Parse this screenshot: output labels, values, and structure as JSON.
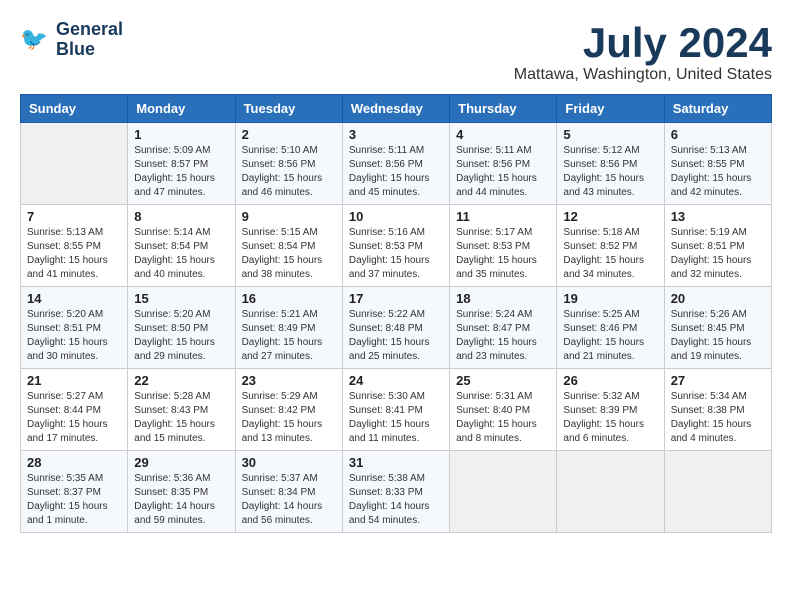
{
  "logo": {
    "line1": "General",
    "line2": "Blue"
  },
  "title": "July 2024",
  "location": "Mattawa, Washington, United States",
  "days_of_week": [
    "Sunday",
    "Monday",
    "Tuesday",
    "Wednesday",
    "Thursday",
    "Friday",
    "Saturday"
  ],
  "weeks": [
    [
      {
        "day": "",
        "info": ""
      },
      {
        "day": "1",
        "info": "Sunrise: 5:09 AM\nSunset: 8:57 PM\nDaylight: 15 hours\nand 47 minutes."
      },
      {
        "day": "2",
        "info": "Sunrise: 5:10 AM\nSunset: 8:56 PM\nDaylight: 15 hours\nand 46 minutes."
      },
      {
        "day": "3",
        "info": "Sunrise: 5:11 AM\nSunset: 8:56 PM\nDaylight: 15 hours\nand 45 minutes."
      },
      {
        "day": "4",
        "info": "Sunrise: 5:11 AM\nSunset: 8:56 PM\nDaylight: 15 hours\nand 44 minutes."
      },
      {
        "day": "5",
        "info": "Sunrise: 5:12 AM\nSunset: 8:56 PM\nDaylight: 15 hours\nand 43 minutes."
      },
      {
        "day": "6",
        "info": "Sunrise: 5:13 AM\nSunset: 8:55 PM\nDaylight: 15 hours\nand 42 minutes."
      }
    ],
    [
      {
        "day": "7",
        "info": "Sunrise: 5:13 AM\nSunset: 8:55 PM\nDaylight: 15 hours\nand 41 minutes."
      },
      {
        "day": "8",
        "info": "Sunrise: 5:14 AM\nSunset: 8:54 PM\nDaylight: 15 hours\nand 40 minutes."
      },
      {
        "day": "9",
        "info": "Sunrise: 5:15 AM\nSunset: 8:54 PM\nDaylight: 15 hours\nand 38 minutes."
      },
      {
        "day": "10",
        "info": "Sunrise: 5:16 AM\nSunset: 8:53 PM\nDaylight: 15 hours\nand 37 minutes."
      },
      {
        "day": "11",
        "info": "Sunrise: 5:17 AM\nSunset: 8:53 PM\nDaylight: 15 hours\nand 35 minutes."
      },
      {
        "day": "12",
        "info": "Sunrise: 5:18 AM\nSunset: 8:52 PM\nDaylight: 15 hours\nand 34 minutes."
      },
      {
        "day": "13",
        "info": "Sunrise: 5:19 AM\nSunset: 8:51 PM\nDaylight: 15 hours\nand 32 minutes."
      }
    ],
    [
      {
        "day": "14",
        "info": "Sunrise: 5:20 AM\nSunset: 8:51 PM\nDaylight: 15 hours\nand 30 minutes."
      },
      {
        "day": "15",
        "info": "Sunrise: 5:20 AM\nSunset: 8:50 PM\nDaylight: 15 hours\nand 29 minutes."
      },
      {
        "day": "16",
        "info": "Sunrise: 5:21 AM\nSunset: 8:49 PM\nDaylight: 15 hours\nand 27 minutes."
      },
      {
        "day": "17",
        "info": "Sunrise: 5:22 AM\nSunset: 8:48 PM\nDaylight: 15 hours\nand 25 minutes."
      },
      {
        "day": "18",
        "info": "Sunrise: 5:24 AM\nSunset: 8:47 PM\nDaylight: 15 hours\nand 23 minutes."
      },
      {
        "day": "19",
        "info": "Sunrise: 5:25 AM\nSunset: 8:46 PM\nDaylight: 15 hours\nand 21 minutes."
      },
      {
        "day": "20",
        "info": "Sunrise: 5:26 AM\nSunset: 8:45 PM\nDaylight: 15 hours\nand 19 minutes."
      }
    ],
    [
      {
        "day": "21",
        "info": "Sunrise: 5:27 AM\nSunset: 8:44 PM\nDaylight: 15 hours\nand 17 minutes."
      },
      {
        "day": "22",
        "info": "Sunrise: 5:28 AM\nSunset: 8:43 PM\nDaylight: 15 hours\nand 15 minutes."
      },
      {
        "day": "23",
        "info": "Sunrise: 5:29 AM\nSunset: 8:42 PM\nDaylight: 15 hours\nand 13 minutes."
      },
      {
        "day": "24",
        "info": "Sunrise: 5:30 AM\nSunset: 8:41 PM\nDaylight: 15 hours\nand 11 minutes."
      },
      {
        "day": "25",
        "info": "Sunrise: 5:31 AM\nSunset: 8:40 PM\nDaylight: 15 hours\nand 8 minutes."
      },
      {
        "day": "26",
        "info": "Sunrise: 5:32 AM\nSunset: 8:39 PM\nDaylight: 15 hours\nand 6 minutes."
      },
      {
        "day": "27",
        "info": "Sunrise: 5:34 AM\nSunset: 8:38 PM\nDaylight: 15 hours\nand 4 minutes."
      }
    ],
    [
      {
        "day": "28",
        "info": "Sunrise: 5:35 AM\nSunset: 8:37 PM\nDaylight: 15 hours\nand 1 minute."
      },
      {
        "day": "29",
        "info": "Sunrise: 5:36 AM\nSunset: 8:35 PM\nDaylight: 14 hours\nand 59 minutes."
      },
      {
        "day": "30",
        "info": "Sunrise: 5:37 AM\nSunset: 8:34 PM\nDaylight: 14 hours\nand 56 minutes."
      },
      {
        "day": "31",
        "info": "Sunrise: 5:38 AM\nSunset: 8:33 PM\nDaylight: 14 hours\nand 54 minutes."
      },
      {
        "day": "",
        "info": ""
      },
      {
        "day": "",
        "info": ""
      },
      {
        "day": "",
        "info": ""
      }
    ]
  ]
}
